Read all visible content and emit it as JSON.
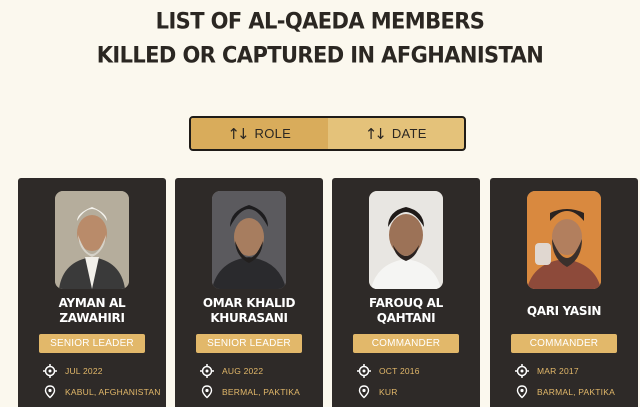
{
  "header": {
    "line1": "LIST OF AL-QAEDA MEMBERS",
    "line2": "KILLED OR CAPTURED IN AFGHANISTAN"
  },
  "sort": {
    "role_label": "ROLE",
    "date_label": "DATE",
    "active": "ROLE",
    "icon": "sort-arrows-icon"
  },
  "members": [
    {
      "name": "AYMAN AL ZAWAHIRI",
      "name_l1": "AYMAN AL",
      "name_l2": "ZAWAHIRI",
      "role": "SENIOR LEADER",
      "date": "JUL 2022",
      "place": "KABUL, AFGHANISTAN"
    },
    {
      "name": "OMAR KHALID KHURASANI",
      "name_l1": "OMAR KHALID",
      "name_l2": "KHURASANI",
      "role": "SENIOR LEADER",
      "date": "AUG 2022",
      "place": "BERMAL, PAKTIKA"
    },
    {
      "name": "FAROUQ AL QAHTANI",
      "name_l1": "FAROUQ AL",
      "name_l2": "QAHTANI",
      "role": "COMMANDER",
      "date": "OCT 2016",
      "place": "KUR"
    },
    {
      "name": "QARI YASIN",
      "name_l1": "QARI YASIN",
      "name_l2": "",
      "role": "COMMANDER",
      "date": "MAR 2017",
      "place": "BARMAL, PAKTIKA"
    }
  ],
  "colors": {
    "background": "#fbf8ee",
    "card": "#2e2a28",
    "accent": "#e2b86a",
    "toggle_active": "#d9ac5b",
    "toggle": "#e4c27a"
  }
}
